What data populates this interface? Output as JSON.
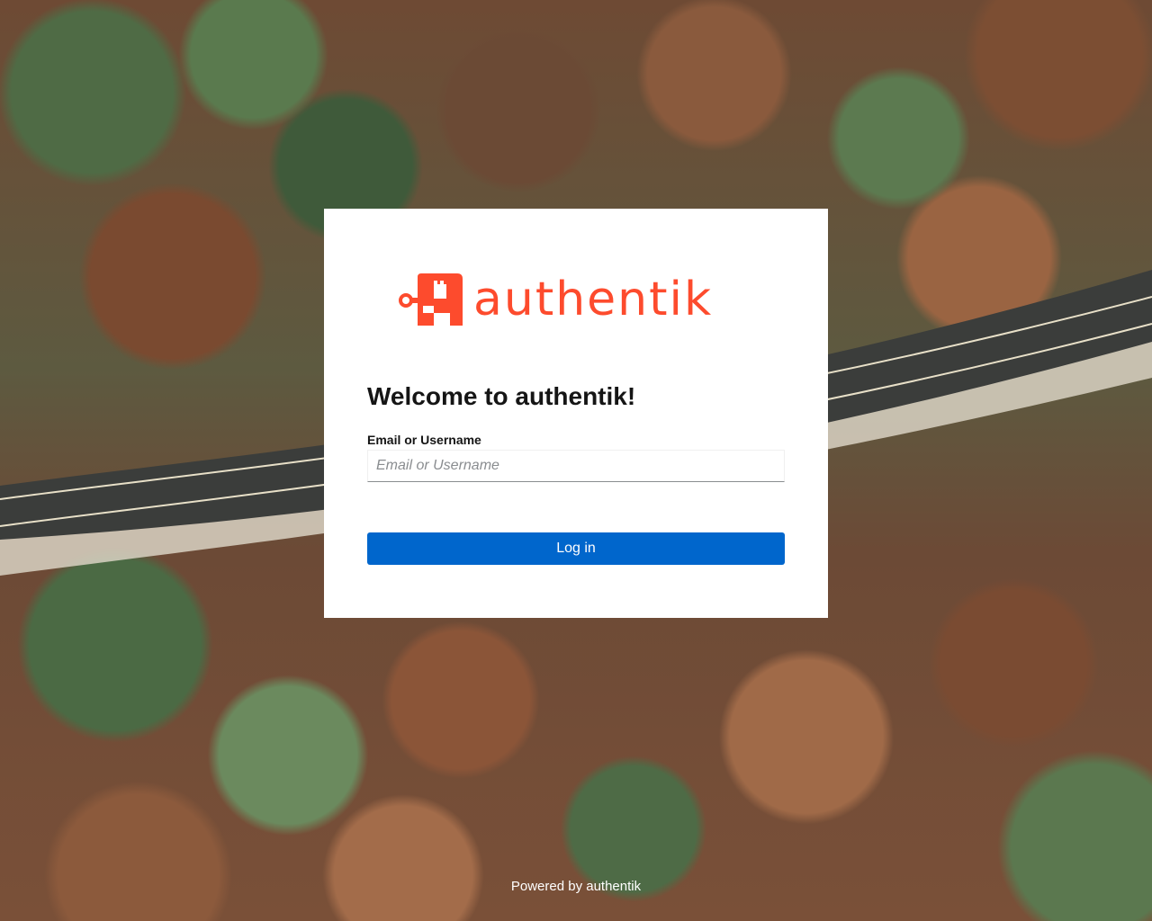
{
  "brand": {
    "name": "authentik",
    "color": "#fd4b2d"
  },
  "login": {
    "title": "Welcome to authentik!",
    "field_label": "Email or Username",
    "field_placeholder": "Email or Username",
    "field_value": "",
    "submit_label": "Log in"
  },
  "footer": {
    "text": "Powered by authentik"
  },
  "colors": {
    "primary_button": "#0066cc",
    "card_background": "#ffffff"
  }
}
